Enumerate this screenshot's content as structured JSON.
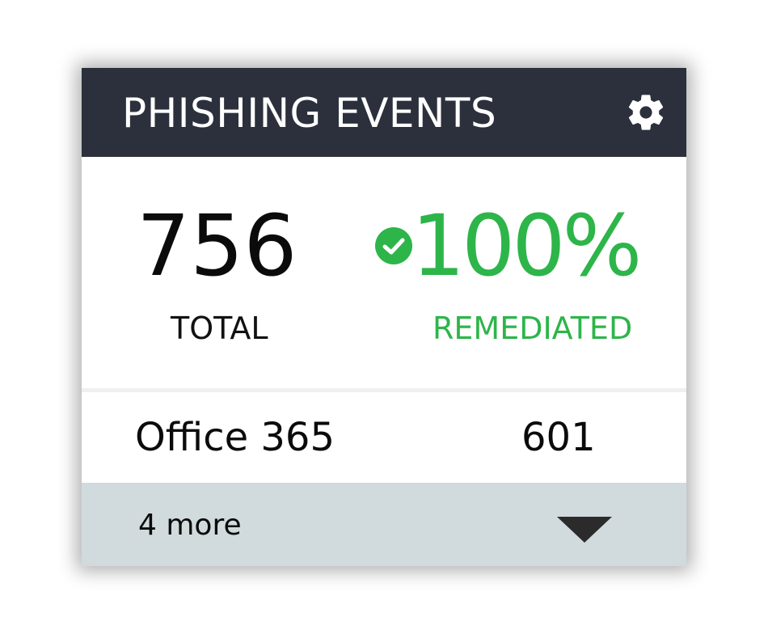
{
  "widget": {
    "title": "PHISHING EVENTS",
    "settings_icon": "gear-icon"
  },
  "summary": {
    "total_value": "756",
    "total_label": "TOTAL",
    "remediated_value": "100%",
    "remediated_label": "REMEDIATED",
    "remediated_icon": "check-circle-icon"
  },
  "source": {
    "name": "Office 365",
    "count": "601"
  },
  "more": {
    "label": "4 more",
    "icon": "caret-down-icon"
  },
  "colors": {
    "header_bg": "#2b303c",
    "success": "#2db54a",
    "more_bar_bg": "#d1dadd"
  }
}
